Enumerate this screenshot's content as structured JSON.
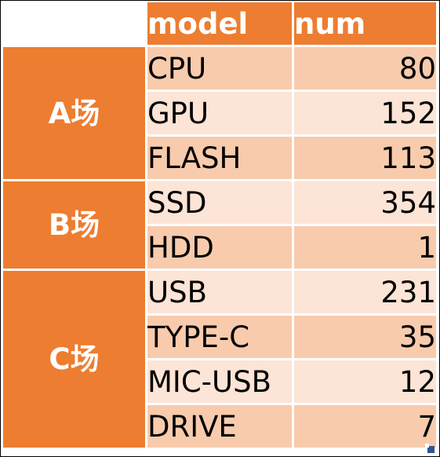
{
  "table": {
    "headers": {
      "model": "model",
      "num": "num"
    },
    "groups": [
      {
        "label": "A场",
        "rows": [
          {
            "model": "CPU",
            "num": "80"
          },
          {
            "model": "GPU",
            "num": "152"
          },
          {
            "model": "FLASH",
            "num": "113"
          }
        ]
      },
      {
        "label": "B场",
        "rows": [
          {
            "model": "SSD",
            "num": "354"
          },
          {
            "model": "HDD",
            "num": "1"
          }
        ]
      },
      {
        "label": "C场",
        "rows": [
          {
            "model": "USB",
            "num": "231"
          },
          {
            "model": "TYPE-C",
            "num": "35"
          },
          {
            "model": "MIC-USB",
            "num": "12"
          },
          {
            "model": "DRIVE",
            "num": "7"
          }
        ]
      }
    ]
  },
  "colors": {
    "header": "#ed7d31",
    "row_dark": "#f8cbad",
    "row_light": "#fce4d6",
    "fill_handle": "#2f5597"
  }
}
